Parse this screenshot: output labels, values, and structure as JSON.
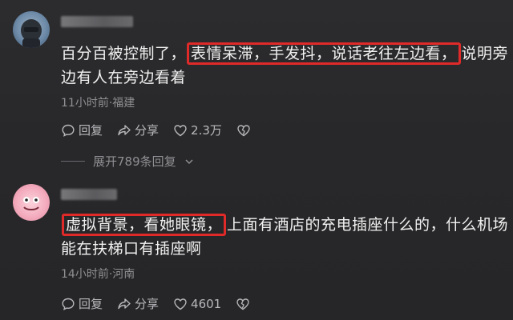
{
  "comments": [
    {
      "text_before": "百分百被控制了，",
      "highlight": "表情呆滞，手发抖，说话老往左边看，",
      "text_after": "说明旁边有人在旁边看着",
      "meta": "11小时前·福建",
      "reply_label": "回复",
      "share_label": "分享",
      "like_count": "2.3万"
    },
    {
      "text_before": "",
      "highlight": "虚拟背景，看她眼镜，",
      "text_after": "上面有酒店的充电插座什么的，什么机场能在扶梯口有插座啊",
      "meta": "14小时前·河南",
      "reply_label": "回复",
      "share_label": "分享",
      "like_count": "4601"
    }
  ],
  "expand_replies": "展开789条回复",
  "colors": {
    "highlight_border": "#e02a2a",
    "muted": "#8f8f93",
    "background": "#2a2a2c"
  }
}
